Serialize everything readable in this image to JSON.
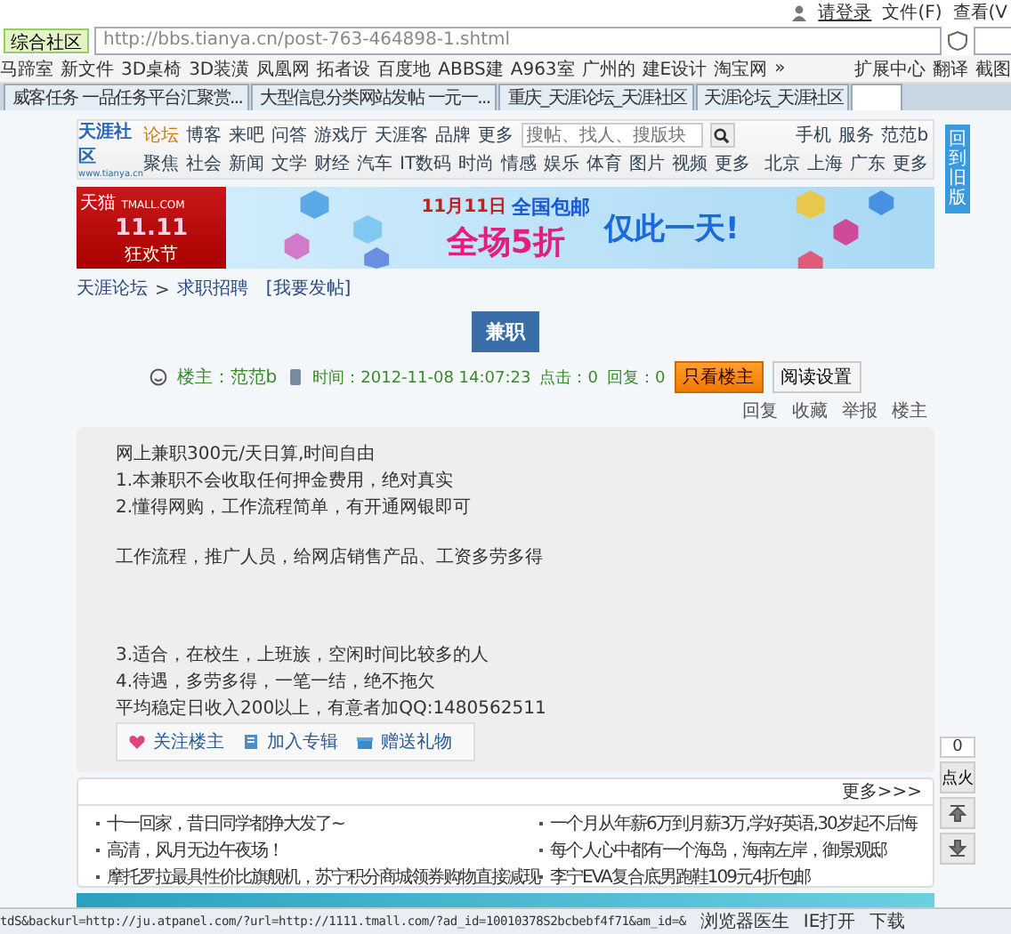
{
  "browser": {
    "login": "请登录",
    "menu": [
      "文件(F)",
      "查看(V"
    ],
    "site_dropdown": "综合社区",
    "address": "http://bbs.tianya.cn/post-763-464898-1.shtml",
    "bookmarks": [
      "马蹄室",
      "新文件",
      "3D桌椅",
      "3D装潢",
      "凤凰网",
      "拓者设",
      "百度地",
      "ABBS建",
      "A963室",
      "广州的",
      "建E设计",
      "淘宝网"
    ],
    "bookmarks_more": "»",
    "tools": [
      "扩展中心",
      "翻译",
      "截图"
    ],
    "tabs": [
      {
        "label": "威客任务 一品任务平台汇聚赏...",
        "selected": false
      },
      {
        "label": "大型信息分类网站发帖 一元一...",
        "selected": false
      },
      {
        "label": "重庆_天涯论坛_天涯社区",
        "selected": false
      },
      {
        "label": "天涯论坛_天涯社区",
        "selected": false
      },
      {
        "selected": true
      }
    ]
  },
  "header": {
    "logo": "天涯社区",
    "logo_url": "www.tianya.cn",
    "nav": [
      {
        "label": "论坛",
        "selected": true
      },
      {
        "label": "博客",
        "selected": false
      },
      {
        "label": "来吧",
        "selected": false
      },
      {
        "label": "问答",
        "selected": false
      },
      {
        "label": "游戏厅",
        "selected": false
      },
      {
        "label": "天涯客",
        "selected": false
      },
      {
        "label": "品牌",
        "selected": false
      },
      {
        "label": "更多",
        "selected": false
      }
    ],
    "search": {
      "placeholder": "搜帖、找人、搜版块"
    },
    "user_links": [
      "手机",
      "服务",
      "范范b"
    ],
    "channels": [
      "聚焦",
      "社会",
      "新闻",
      "文学",
      "财经",
      "汽车",
      "IT数码",
      "时尚",
      "情感",
      "娱乐",
      "体育",
      "图片",
      "视频",
      "更多"
    ],
    "regions": [
      "北京",
      "上海",
      "广东",
      "更多"
    ]
  },
  "banner": {
    "brand": "天猫",
    "brand_url": "TMALL.COM",
    "event": "11.11",
    "event_sub": "狂欢节",
    "date": "11月11日",
    "shipping": "全国包邮",
    "discount": "全场5折",
    "slogan": "仅此一天!"
  },
  "breadcrumb": {
    "items": [
      "天涯论坛",
      "求职招聘"
    ],
    "separator": ">",
    "post_link": "[我要发帖]"
  },
  "back_to_old": "回到旧版",
  "post": {
    "title": "兼职",
    "author": "楼主：范范b",
    "time": "时间：2012-11-08 14:07:23",
    "clicks": "点击：0",
    "replies": "回复：0",
    "buttons": [
      "只看楼主",
      "阅读设置"
    ],
    "actions": [
      "回复",
      "收藏",
      "举报",
      "楼主"
    ],
    "paragraphs": [
      {
        "kind": "line",
        "text": "网上兼职300元/天日算,时间自由"
      },
      {
        "kind": "line",
        "text": "1.本兼职不会收取任何押金费用，绝对真实"
      },
      {
        "kind": "line",
        "text": "2.懂得网购，工作流程简单，有开通网银即可"
      },
      {
        "kind": "gap"
      },
      {
        "kind": "line",
        "text": "工作流程，推广人员，给网店销售产品、工资多劳多得"
      },
      {
        "kind": "gap"
      },
      {
        "kind": "gap"
      },
      {
        "kind": "gap"
      },
      {
        "kind": "line",
        "text": "3.适合，在校生，上班族，空闲时间比较多的人"
      },
      {
        "kind": "line",
        "text": "4.待遇，多劳多得，一笔一结，绝不拖欠"
      },
      {
        "kind": "line",
        "text": "平均稳定日收入200以上，有意者加QQ:1480562511"
      }
    ],
    "footer_actions": [
      "关注楼主",
      "加入专辑",
      "赠送礼物"
    ]
  },
  "recommend": {
    "more": "更多>>>",
    "items": [
      "十一回家，昔日同学都挣大发了~",
      "一个月从年薪6万到月薪3万,学好英语,30岁起不后悔",
      "高清，风月无边午夜场！",
      "每个人心中都有一个海岛，海南左岸，御景观邸",
      "摩托罗拉最具性价比旗舰机，苏宁积分商城领券购物直接减现",
      "李宁EVA复合底男跑鞋109元4折包邮"
    ]
  },
  "side_tools": {
    "count": "0",
    "fire": "点火"
  },
  "status_bar": {
    "url": "tdS&backurl=http://ju.atpanel.com/?url=http://1111.tmall.com/?ad_id=10010378S2bcbebf4f71&am_id=&",
    "items": [
      "浏览器医生",
      "IE打开",
      "下载"
    ]
  }
}
